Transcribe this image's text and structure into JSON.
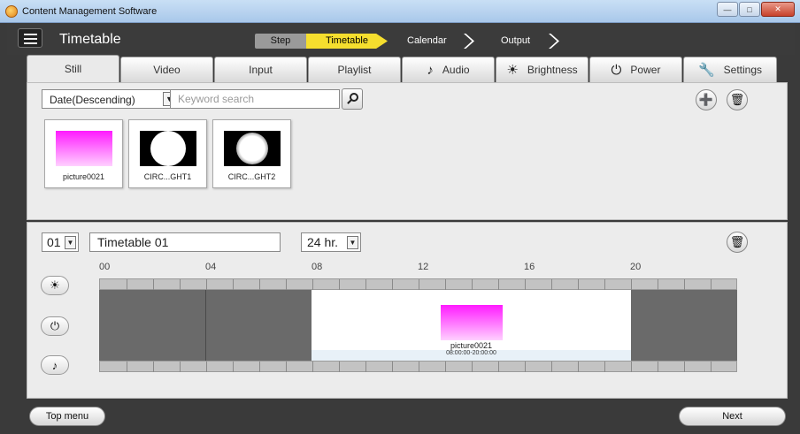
{
  "window": {
    "title": "Content Management Software"
  },
  "header": {
    "title": "Timetable"
  },
  "steps": {
    "label": "Step",
    "items": [
      "Timetable",
      "Calendar",
      "Output"
    ],
    "active": "Timetable"
  },
  "tabs": [
    "Still",
    "Video",
    "Input",
    "Playlist",
    "Audio",
    "Brightness",
    "Power",
    "Settings"
  ],
  "library": {
    "sort": "Date(Descending)",
    "search_placeholder": "Keyword search",
    "items": [
      "picture0021",
      "CIRC...GHT1",
      "CIRC...GHT2"
    ]
  },
  "timetable": {
    "number": "01",
    "name": "Timetable 01",
    "hour_mode": "24 hr.",
    "hours": [
      "00",
      "04",
      "08",
      "12",
      "16",
      "20"
    ],
    "event": {
      "name": "picture0021",
      "time": "08:00:00-20:00:00"
    }
  },
  "footer": {
    "top_menu": "Top menu",
    "next": "Next"
  }
}
